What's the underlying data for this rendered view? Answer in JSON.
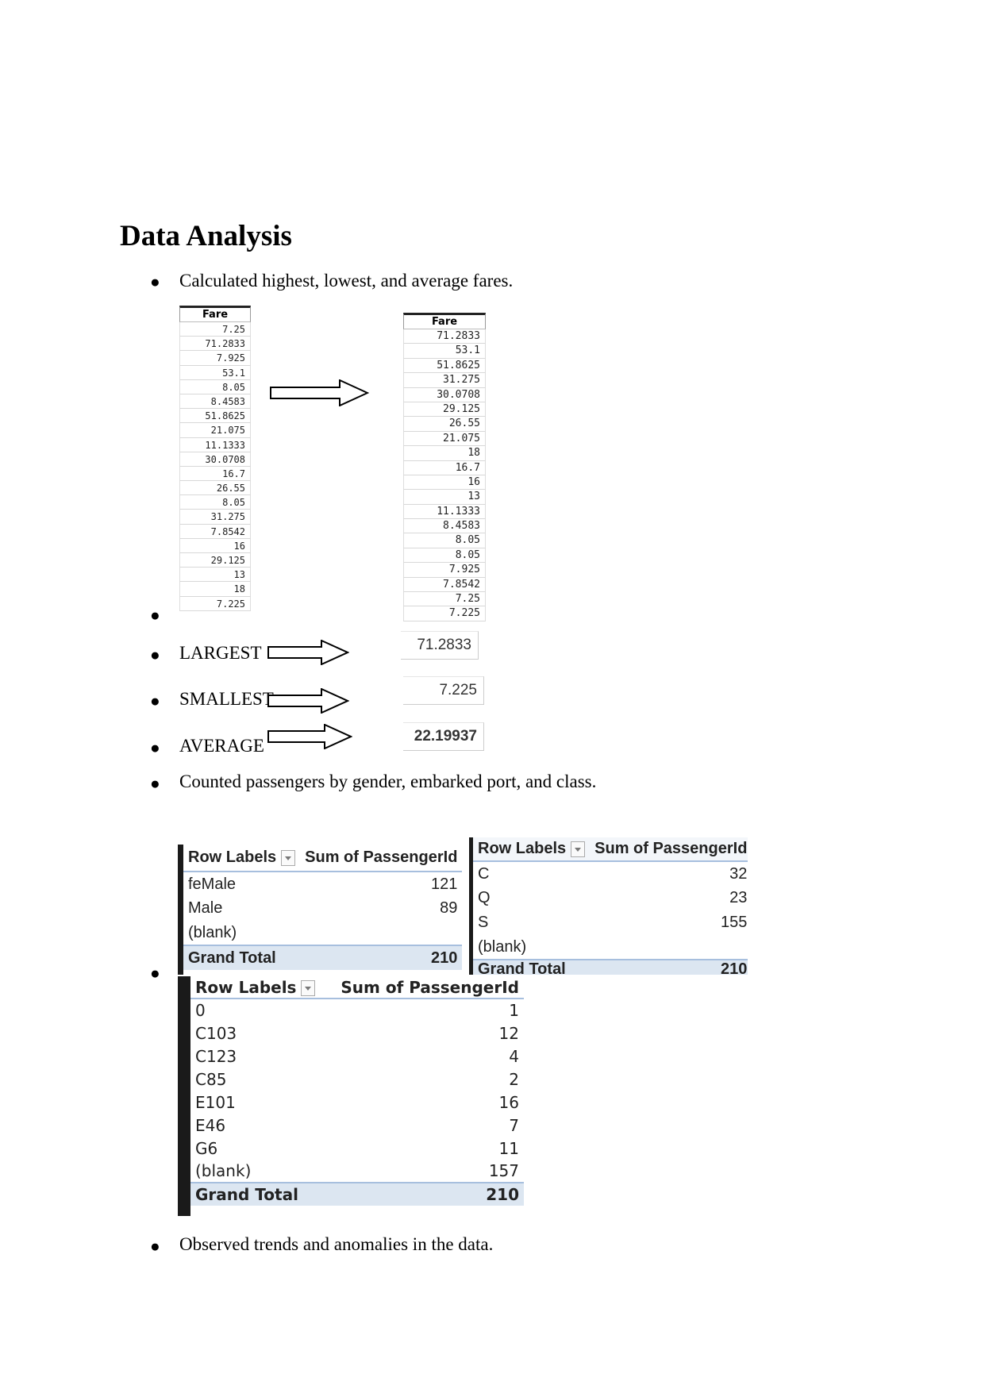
{
  "heading": "Data Analysis",
  "bullets": {
    "calc": "Calculated highest, lowest, and average fares.",
    "largest": "LARGEST",
    "smallest": "SMALLEST",
    "average": "AVERAGE",
    "counted": "Counted passengers by gender, embarked port, and class.",
    "observed": "Observed trends and anomalies in the data."
  },
  "fare_original": {
    "header": "Fare",
    "values": [
      "7.25",
      "71.2833",
      "7.925",
      "53.1",
      "8.05",
      "8.4583",
      "51.8625",
      "21.075",
      "11.1333",
      "30.0708",
      "16.7",
      "26.55",
      "8.05",
      "31.275",
      "7.8542",
      "16",
      "29.125",
      "13",
      "18",
      "7.225"
    ]
  },
  "fare_sorted": {
    "header": "Fare",
    "values": [
      "71.2833",
      "53.1",
      "51.8625",
      "31.275",
      "30.0708",
      "29.125",
      "26.55",
      "21.075",
      "18",
      "16.7",
      "16",
      "13",
      "11.1333",
      "8.4583",
      "8.05",
      "8.05",
      "7.925",
      "7.8542",
      "7.25",
      "7.225"
    ]
  },
  "stats": {
    "largest": "71.2833",
    "smallest": "7.225",
    "average": "22.19937"
  },
  "pivot_gender": {
    "col1": "Row Labels",
    "col2": "Sum of PassengerId",
    "rows": [
      {
        "label": "feMale",
        "value": "121"
      },
      {
        "label": "Male",
        "value": "89"
      },
      {
        "label": "(blank)",
        "value": ""
      }
    ],
    "total_label": "Grand Total",
    "total_value": "210"
  },
  "pivot_port": {
    "col1": "Row Labels",
    "col2": "Sum of PassengerId",
    "rows": [
      {
        "label": "C",
        "value": "32"
      },
      {
        "label": "Q",
        "value": "23"
      },
      {
        "label": "S",
        "value": "155"
      },
      {
        "label": "(blank)",
        "value": ""
      }
    ],
    "total_label": "Grand Total",
    "total_value": "210"
  },
  "pivot_cabin": {
    "col1": "Row Labels",
    "col2": "Sum of PassengerId",
    "rows": [
      {
        "label": "0",
        "value": "1"
      },
      {
        "label": "C103",
        "value": "12"
      },
      {
        "label": "C123",
        "value": "4"
      },
      {
        "label": "C85",
        "value": "2"
      },
      {
        "label": "E101",
        "value": "16"
      },
      {
        "label": "E46",
        "value": "7"
      },
      {
        "label": "G6",
        "value": "11"
      },
      {
        "label": "(blank)",
        "value": "157"
      }
    ],
    "total_label": "Grand Total",
    "total_value": "210"
  }
}
